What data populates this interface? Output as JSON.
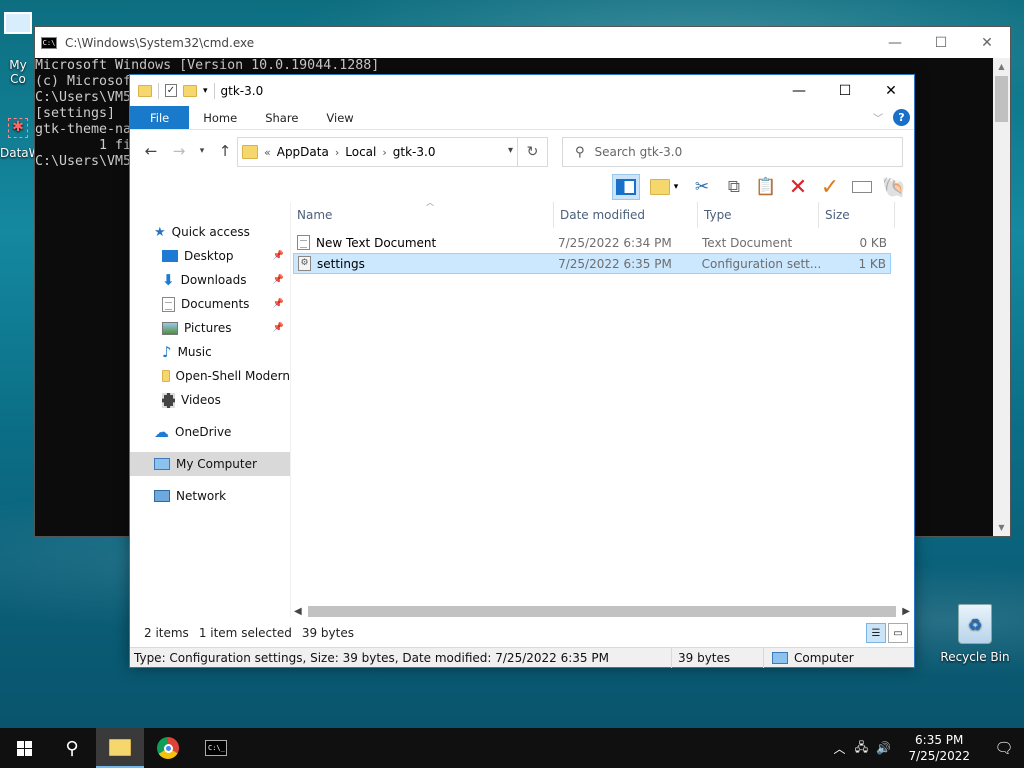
{
  "desktop": {
    "icons": [
      {
        "label": "My Co",
        "icon": "computer-icon"
      },
      {
        "label": "DataW",
        "icon": "app-shortcut-icon"
      },
      {
        "label": "Recycle Bin",
        "icon": "recycle-bin-icon"
      }
    ]
  },
  "cmd": {
    "title": "C:\\Windows\\System32\\cmd.exe",
    "lines": [
      "Microsoft Windows [Version 10.0.19044.1288]",
      "(c) Microsof",
      "",
      "C:\\Users\\VM5",
      "[settings]",
      "gtk-theme-na",
      "        1 fi",
      "",
      "C:\\Users\\VM5"
    ]
  },
  "explorer": {
    "title": "gtk-3.0",
    "ribbon_tabs": [
      "File",
      "Home",
      "Share",
      "View"
    ],
    "breadcrumb": {
      "overflow": "«",
      "parts": [
        "AppData",
        "Local",
        "gtk-3.0"
      ]
    },
    "search_placeholder": "Search gtk-3.0",
    "nav": {
      "quick_access": "Quick access",
      "pinned": [
        {
          "label": "Desktop",
          "icon": "desktop-icon",
          "pinned": true
        },
        {
          "label": "Downloads",
          "icon": "downloads-icon",
          "pinned": true
        },
        {
          "label": "Documents",
          "icon": "documents-icon",
          "pinned": true
        },
        {
          "label": "Pictures",
          "icon": "pictures-icon",
          "pinned": true
        },
        {
          "label": "Music",
          "icon": "music-icon",
          "pinned": false
        },
        {
          "label": "Open-Shell Modern",
          "icon": "folder-icon",
          "pinned": false
        },
        {
          "label": "Videos",
          "icon": "videos-icon",
          "pinned": false
        }
      ],
      "onedrive": "OneDrive",
      "my_computer": "My Computer",
      "network": "Network"
    },
    "columns": [
      "Name",
      "Date modified",
      "Type",
      "Size"
    ],
    "files": [
      {
        "name": "New Text Document",
        "date": "7/25/2022 6:34 PM",
        "type": "Text Document",
        "size": "0 KB",
        "selected": false
      },
      {
        "name": "settings",
        "date": "7/25/2022 6:35 PM",
        "type": "Configuration sett...",
        "size": "1 KB",
        "selected": true
      }
    ],
    "status": {
      "items": "2 items",
      "selected": "1 item selected",
      "bytes": "39 bytes"
    },
    "infobar": {
      "details": "Type: Configuration settings, Size: 39 bytes, Date modified: 7/25/2022 6:35 PM",
      "size": "39 bytes",
      "location": "Computer"
    }
  },
  "taskbar": {
    "time": "6:35 PM",
    "date": "7/25/2022"
  }
}
